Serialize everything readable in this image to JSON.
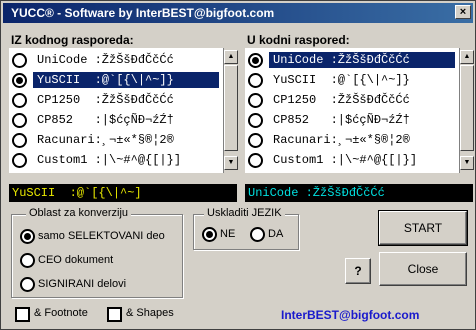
{
  "window": {
    "title": "YUCC® - Software by InterBEST@bigfoot.com",
    "close_label": "×"
  },
  "left_list": {
    "heading": "IZ kodnog rasporeda:",
    "items": [
      {
        "label": "UniCode :ŽžŠšĐđČčĆć",
        "checked": false
      },
      {
        "label": "YuSCII  :@`[{\\|^~]}",
        "checked": true
      },
      {
        "label": "CP1250  :ŽžŠšĐđČčĆć",
        "checked": false
      },
      {
        "label": "CP852   :|$ćçÑÐ¬źŹ†",
        "checked": false
      },
      {
        "label": "Racunari:¸¬±«*§®¦2®",
        "checked": false
      },
      {
        "label": "Custom1 :|\\~#^@{[|}]",
        "checked": false
      }
    ]
  },
  "right_list": {
    "heading": "U kodni raspored:",
    "items": [
      {
        "label": "UniCode :ŽžŠšĐđČčĆć",
        "checked": true
      },
      {
        "label": "YuSCII  :@`[{\\|^~]}",
        "checked": false
      },
      {
        "label": "CP1250  :ŽžŠšĐđČčĆć",
        "checked": false
      },
      {
        "label": "CP852   :|$ćçÑÐ¬źŹ†",
        "checked": false
      },
      {
        "label": "Racunari:¸¬±«*§®¦2®",
        "checked": false
      },
      {
        "label": "Custom1 :|\\~#^@{[|}]",
        "checked": false
      }
    ]
  },
  "preview": {
    "left_text": "YuSCII  :@`[{\\|^~]",
    "right_text": "UniCode :ŽžŠšĐđČčĆć",
    "left_color": "#e8e800",
    "right_color": "#00e0e0"
  },
  "conversion_group": {
    "legend": "Oblast za konverziju",
    "options": [
      {
        "label": "samo SELEKTOVANI deo",
        "checked": true
      },
      {
        "label": "CEO dokument",
        "checked": false
      },
      {
        "label": "SIGNIRANI delovi",
        "checked": false
      }
    ]
  },
  "language_group": {
    "legend": "Uskladiti JEZIK",
    "options": [
      {
        "label": "NE",
        "checked": true
      },
      {
        "label": "DA",
        "checked": false
      }
    ]
  },
  "buttons": {
    "start": "START",
    "help": "?",
    "close": "Close"
  },
  "checkboxes": [
    {
      "label": "& Footnote",
      "checked": false
    },
    {
      "label": "& Shapes",
      "checked": false
    }
  ],
  "footer_email": "InterBEST@bigfoot.com"
}
